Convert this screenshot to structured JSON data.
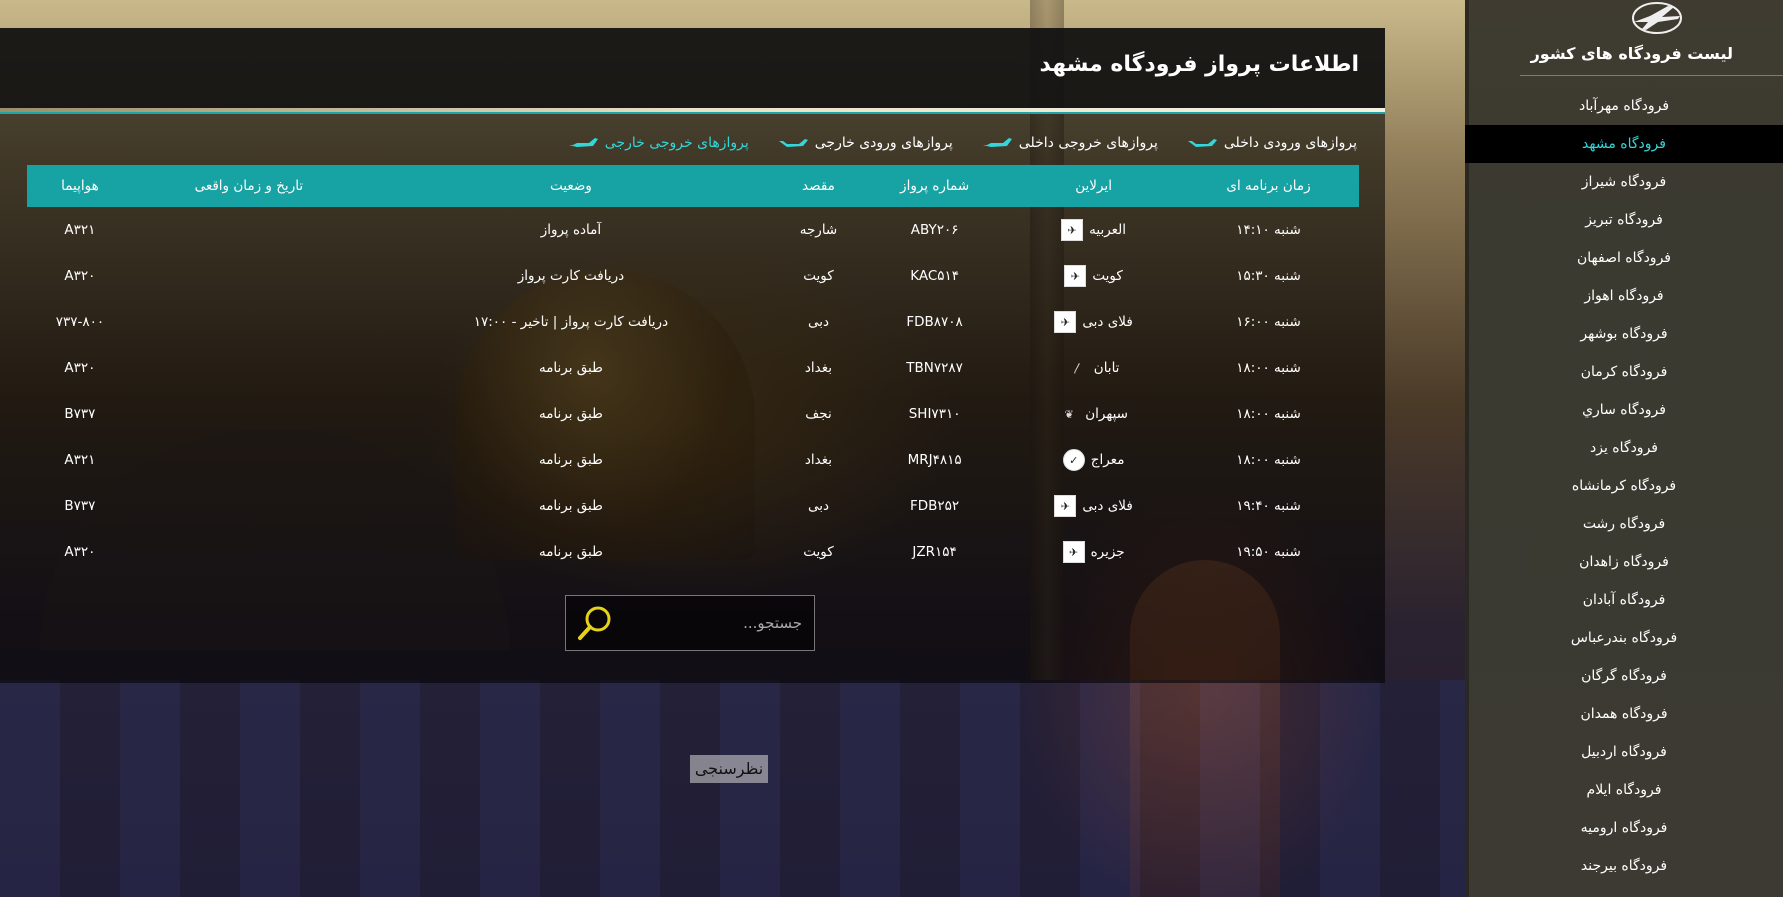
{
  "page_title": "اطلاعات پرواز فرودگاه مشهد",
  "tabs": [
    {
      "label": "پروازهای ورودی داخلی",
      "active": false
    },
    {
      "label": "پروازهای خروجی داخلی",
      "active": false
    },
    {
      "label": "پروازهای ورودی خارجی",
      "active": false
    },
    {
      "label": "پروازهای خروجی خارجی",
      "active": true
    }
  ],
  "table": {
    "headers": [
      "زمان برنامه ای",
      "ایرلاین",
      "شماره پرواز",
      "مقصد",
      "وضعیت",
      "تاریخ و زمان واقعی",
      "هواپیما"
    ],
    "rows": [
      {
        "time": "شنبه ۱۴:۱۰",
        "airline": "العربیه",
        "flight": "ABY۲۰۶",
        "dest": "شارجه",
        "status": "آماده پرواز",
        "actual": "",
        "aircraft": "A۳۲۱",
        "logo": "square-plane-icon"
      },
      {
        "time": "شنبه ۱۵:۳۰",
        "airline": "کویت",
        "flight": "KAC۵۱۴",
        "dest": "کویت",
        "status": "دریافت کارت پرواز",
        "actual": "",
        "aircraft": "A۳۲۰",
        "logo": "square-plane-icon"
      },
      {
        "time": "شنبه ۱۶:۰۰",
        "airline": "فلای دبی",
        "flight": "FDB۸۷۰۸",
        "dest": "دبی",
        "status": "دریافت کارت پرواز | تاخیر - ۱۷:۰۰",
        "actual": "",
        "aircraft": "۷۳۷-۸۰۰",
        "logo": "square-plane-icon"
      },
      {
        "time": "شنبه ۱۸:۰۰",
        "airline": "تابان",
        "flight": "TBN۷۲۸۷",
        "dest": "بغداد",
        "status": "طبق برنامه",
        "actual": "",
        "aircraft": "A۳۲۰",
        "logo": "taban-wing-icon"
      },
      {
        "time": "شنبه ۱۸:۰۰",
        "airline": "سپهران",
        "flight": "SHI۷۳۱۰",
        "dest": "نجف",
        "status": "طبق برنامه",
        "actual": "",
        "aircraft": "B۷۳۷",
        "logo": "sepehran-bird-icon"
      },
      {
        "time": "شنبه ۱۸:۰۰",
        "airline": "معراج",
        "flight": "MRJ۴۸۱۵",
        "dest": "بغداد",
        "status": "طبق برنامه",
        "actual": "",
        "aircraft": "A۳۲۱",
        "logo": "meraj-round-icon"
      },
      {
        "time": "شنبه ۱۹:۴۰",
        "airline": "فلای دبی",
        "flight": "FDB۲۵۲",
        "dest": "دبی",
        "status": "طبق برنامه",
        "actual": "",
        "aircraft": "B۷۳۷",
        "logo": "square-plane-icon"
      },
      {
        "time": "شنبه ۱۹:۵۰",
        "airline": "جزیره",
        "flight": "JZR۱۵۴",
        "dest": "کویت",
        "status": "طبق برنامه",
        "actual": "",
        "aircraft": "A۳۲۰",
        "logo": "square-plane-icon"
      }
    ]
  },
  "search": {
    "placeholder": "جستجو..."
  },
  "survey_label": "نظرسنجی",
  "sidebar": {
    "title": "لیست فرودگاه های کشور",
    "items": [
      {
        "label": "فرودگاه مهرآباد",
        "active": false
      },
      {
        "label": "فرودگاه مشهد",
        "active": true
      },
      {
        "label": "فرودگاه شیراز",
        "active": false
      },
      {
        "label": "فرودگاه تبریز",
        "active": false
      },
      {
        "label": "فرودگاه اصفهان",
        "active": false
      },
      {
        "label": "فرودگاه اهواز",
        "active": false
      },
      {
        "label": "فرودگاه بوشهر",
        "active": false
      },
      {
        "label": "فرودگاه کرمان",
        "active": false
      },
      {
        "label": "فرودگاه ساري",
        "active": false
      },
      {
        "label": "فرودگاه یزد",
        "active": false
      },
      {
        "label": "فرودگاه کرمانشاه",
        "active": false
      },
      {
        "label": "فرودگاه رشت",
        "active": false
      },
      {
        "label": "فرودگاه زاهدان",
        "active": false
      },
      {
        "label": "فرودگاه آبادان",
        "active": false
      },
      {
        "label": "فرودگاه بندرعباس",
        "active": false
      },
      {
        "label": "فرودگاه گرگان",
        "active": false
      },
      {
        "label": "فرودگاه همدان",
        "active": false
      },
      {
        "label": "فرودگاه اردبیل",
        "active": false
      },
      {
        "label": "فرودگاه ایلام",
        "active": false
      },
      {
        "label": "فرودگاه ارومیه",
        "active": false
      },
      {
        "label": "فرودگاه بیرجند",
        "active": false
      }
    ]
  },
  "colors": {
    "accent": "#17a2a4",
    "active_text": "#33d6d9",
    "search_icon": "#e6d21a"
  }
}
